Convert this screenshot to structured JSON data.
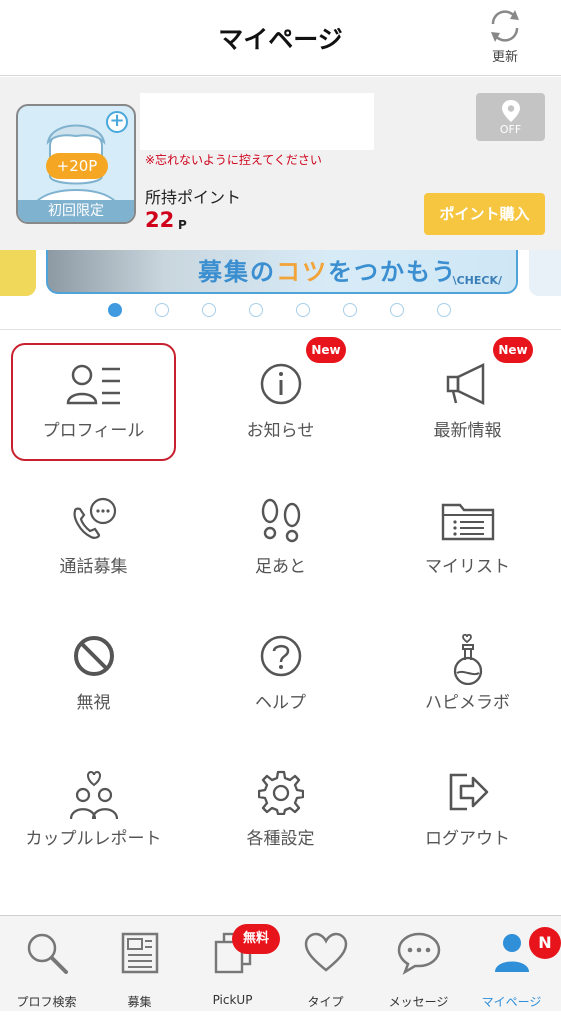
{
  "header": {
    "title": "マイページ",
    "refresh_label": "更新",
    "refresh_icon": "refresh-icon"
  },
  "profile": {
    "avatar_icon": "user-avatar-icon",
    "plus_icon": "plus-icon",
    "bonus": "+20P",
    "first_time_label": "初回限定",
    "notice": "※忘れないように控えてください",
    "points_label": "所持ポイント",
    "points_value": "22",
    "points_unit": "P",
    "location_icon": "location-pin-icon",
    "location_status": "OFF",
    "buy_button": "ポイント購入"
  },
  "banner": {
    "text_a": "募集の",
    "text_b": "コツ",
    "text_c": "をつかもう",
    "check": "\\CHECK/",
    "dots_count": 8,
    "active_dot": 0
  },
  "menu": {
    "items": [
      {
        "label": "プロフィール",
        "icon": "profile-list-icon",
        "new": false
      },
      {
        "label": "お知らせ",
        "icon": "info-icon",
        "new": true
      },
      {
        "label": "最新情報",
        "icon": "megaphone-icon",
        "new": true
      },
      {
        "label": "通話募集",
        "icon": "phone-chat-icon",
        "new": false
      },
      {
        "label": "足あと",
        "icon": "footprints-icon",
        "new": false
      },
      {
        "label": "マイリスト",
        "icon": "folder-list-icon",
        "new": false
      },
      {
        "label": "無視",
        "icon": "block-icon",
        "new": false
      },
      {
        "label": "ヘルプ",
        "icon": "help-icon",
        "new": false
      },
      {
        "label": "ハピメラボ",
        "icon": "flask-icon",
        "new": false
      },
      {
        "label": "カップルレポート",
        "icon": "couple-heart-icon",
        "new": false
      },
      {
        "label": "各種設定",
        "icon": "gear-icon",
        "new": false
      },
      {
        "label": "ログアウト",
        "icon": "logout-icon",
        "new": false
      }
    ],
    "new_badge": "New"
  },
  "bottom_nav": {
    "tabs": [
      {
        "label": "プロフ検索",
        "icon": "search-icon"
      },
      {
        "label": "募集",
        "icon": "board-icon"
      },
      {
        "label": "PickUP",
        "icon": "photo-stack-icon"
      },
      {
        "label": "タイプ",
        "icon": "heart-icon"
      },
      {
        "label": "メッセージ",
        "icon": "chat-bubble-icon"
      },
      {
        "label": "マイページ",
        "icon": "person-icon"
      }
    ],
    "active_tab": "マイページ",
    "free_badge": "無料",
    "notification_badge": "N"
  },
  "colors": {
    "accent_blue": "#2f8fd8",
    "badge_red": "#e8141b",
    "buy_yellow": "#f7c641",
    "highlight_red": "#c8202e"
  }
}
